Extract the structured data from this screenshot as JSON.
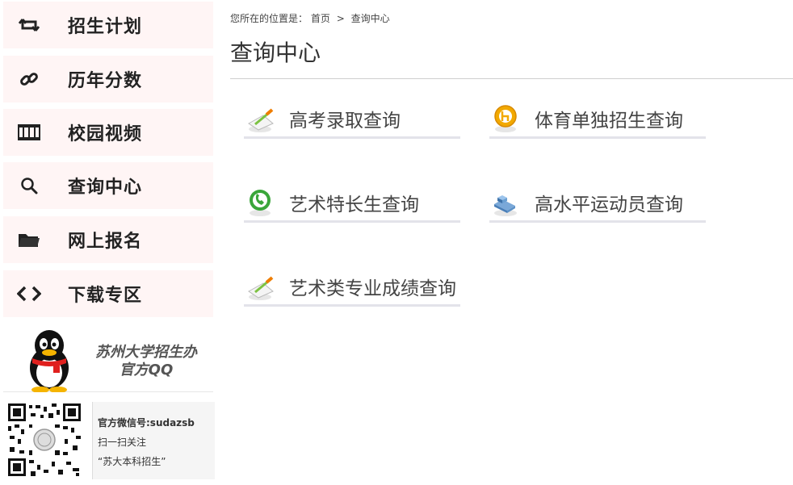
{
  "sidebar": {
    "items": [
      {
        "label": "招生计划",
        "icon": "retweet-icon"
      },
      {
        "label": "历年分数",
        "icon": "link-icon"
      },
      {
        "label": "校园视频",
        "icon": "film-icon"
      },
      {
        "label": "查询中心",
        "icon": "search-icon"
      },
      {
        "label": "网上报名",
        "icon": "folder-icon"
      },
      {
        "label": "下载专区",
        "icon": "code-icon"
      }
    ],
    "qq": {
      "line1": "苏州大学招生办",
      "line2": "官方QQ"
    },
    "wechat": {
      "account": "官方微信号:sudazsb",
      "scan": "扫一扫关注",
      "name": "“苏大本科招生”"
    }
  },
  "breadcrumb": {
    "prefix": "您所在的位置是：",
    "home": "首页",
    "separator": ">",
    "current": "查询中心"
  },
  "main": {
    "title": "查询中心",
    "links": [
      {
        "label": "高考录取查询",
        "icon": "pencil-paper-icon"
      },
      {
        "label": "体育单独招生查询",
        "icon": "orange-badge-icon"
      },
      {
        "label": "艺术特长生查询",
        "icon": "green-phone-icon"
      },
      {
        "label": "高水平运动员查询",
        "icon": "blue-cubes-icon"
      },
      {
        "label": "艺术类专业成绩查询",
        "icon": "pencil-paper-icon"
      }
    ]
  }
}
